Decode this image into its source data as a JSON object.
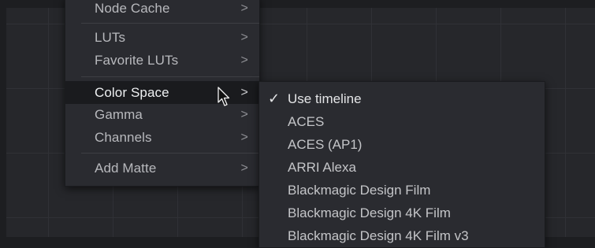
{
  "context_menu": {
    "items": [
      {
        "label": "Node Cache",
        "chevron": ">"
      },
      {
        "label": "LUTs",
        "chevron": ">"
      },
      {
        "label": "Favorite LUTs",
        "chevron": ">"
      },
      {
        "label": "Color Space",
        "chevron": ">"
      },
      {
        "label": "Gamma",
        "chevron": ">"
      },
      {
        "label": "Channels",
        "chevron": ">"
      },
      {
        "label": "Add Matte",
        "chevron": ">"
      }
    ]
  },
  "color_space_submenu": {
    "check_mark": "✓",
    "items": [
      {
        "label": "Use timeline",
        "checked": true
      },
      {
        "label": "ACES"
      },
      {
        "label": "ACES (AP1)"
      },
      {
        "label": "ARRI Alexa"
      },
      {
        "label": "Blackmagic Design Film"
      },
      {
        "label": "Blackmagic Design 4K Film"
      },
      {
        "label": "Blackmagic Design 4K Film v3"
      }
    ]
  },
  "colors": {
    "background": "#26272b",
    "menu": "#2a2b30",
    "highlight": "#1a1b1e",
    "text": "#b8b9bd"
  }
}
